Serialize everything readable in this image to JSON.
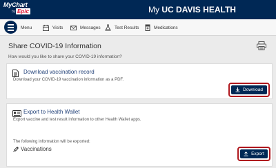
{
  "header": {
    "logo": {
      "mychart": "MyChart",
      "by": "by",
      "epic": "Epic"
    },
    "brand": {
      "my": "My",
      "uc": "UC",
      "davis": "DAVIS",
      "health": "HEALTH"
    }
  },
  "nav": {
    "menu": "Menu",
    "items": [
      {
        "label": "Visits",
        "icon": "calendar-icon"
      },
      {
        "label": "Messages",
        "icon": "envelope-icon"
      },
      {
        "label": "Test Results",
        "icon": "flask-icon"
      },
      {
        "label": "Medications",
        "icon": "pill-bottle-icon"
      }
    ]
  },
  "page": {
    "title": "Share COVID-19 Information",
    "subtitle": "How would you like to share your COVID-19 information?"
  },
  "download_card": {
    "title": "Download vaccination record",
    "description": "Download your COVID-19 vaccination information as a PDF.",
    "button": "Download"
  },
  "wallet_card": {
    "title": "Export to Health Wallet",
    "description": "Export vaccine and test result information to other Health Wallet apps.",
    "exported_label": "The following information will be exported:",
    "item": "Vaccinations",
    "button": "Export"
  },
  "colors": {
    "navy": "#002855",
    "highlight": "#b0181e",
    "link": "#1f3f77"
  }
}
